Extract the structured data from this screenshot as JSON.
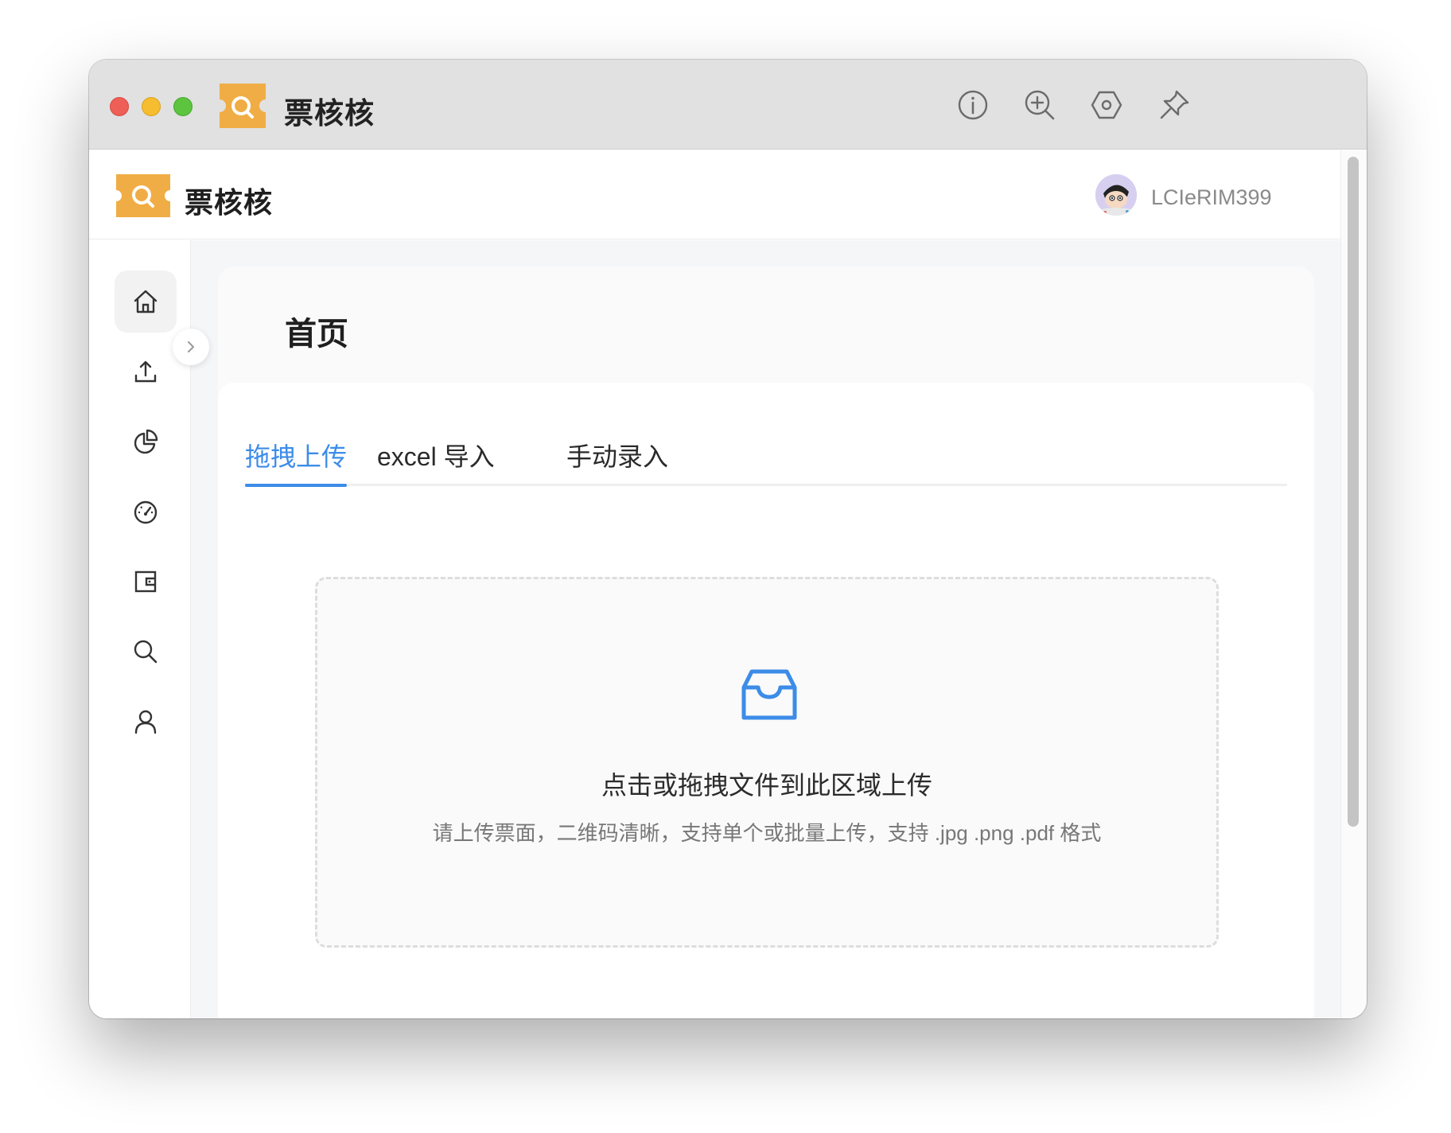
{
  "window": {
    "title": "票核核"
  },
  "titlebar": {
    "buttons": [
      {
        "name": "info-icon"
      },
      {
        "name": "zoom-in-icon"
      },
      {
        "name": "hexagon-settings-icon"
      },
      {
        "name": "pin-icon"
      }
    ]
  },
  "header": {
    "app_name": "票核核",
    "username": "LCIeRIM399"
  },
  "sidebar": {
    "items": [
      {
        "name": "home-icon",
        "active": true
      },
      {
        "name": "upload-icon"
      },
      {
        "name": "pie-chart-icon"
      },
      {
        "name": "dashboard-gauge-icon"
      },
      {
        "name": "wallet-icon"
      },
      {
        "name": "search-icon"
      },
      {
        "name": "user-icon"
      }
    ]
  },
  "main": {
    "page_title": "首页",
    "tabs": [
      {
        "label": "拖拽上传",
        "active": true
      },
      {
        "label": "excel 导入"
      },
      {
        "label": "手动录入"
      }
    ],
    "dropzone": {
      "title": "点击或拖拽文件到此区域上传",
      "hint": "请上传票面，二维码清晰，支持单个或批量上传，支持 .jpg .png .pdf 格式"
    }
  },
  "colors": {
    "accent": "#3c8ce8",
    "brand_orange": "#f0ad45"
  }
}
